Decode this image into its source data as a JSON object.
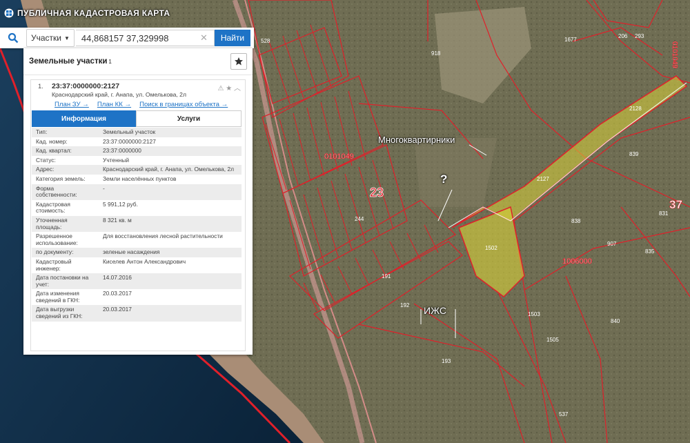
{
  "app": {
    "title": "ПУБЛИЧНАЯ КАДАСТРОВАЯ КАРТА"
  },
  "search": {
    "type_label": "Участки",
    "value": "44,868157 37,329998",
    "button_label": "Найти"
  },
  "results": {
    "header": "Земельные участки",
    "count": "1",
    "item": {
      "index": "1.",
      "cadastral_number": "23:37:0000000:2127",
      "address": "Краснодарский край, г. Анапа, ул. Омелькова, 2л",
      "links": {
        "plan_zu": "План ЗУ →",
        "plan_kk": "План КК →",
        "search_bounds": "Поиск в границах объекта →"
      },
      "tabs": {
        "info": "Информация",
        "services": "Услуги"
      },
      "rows": [
        {
          "key": "Тип:",
          "value": "Земельный участок"
        },
        {
          "key": "Кад. номер:",
          "value": "23:37:0000000:2127"
        },
        {
          "key": "Кад. квартал:",
          "value": "23:37:0000000"
        },
        {
          "key": "Статус:",
          "value": "Учтенный"
        },
        {
          "key": "Адрес:",
          "value": "Краснодарский край, г. Анапа, ул. Омелькова, 2л"
        },
        {
          "key": "Категория земель:",
          "value": "Земли населённых пунктов"
        },
        {
          "key": "Форма собственности:",
          "value": "-"
        },
        {
          "key": "Кадастровая стоимость:",
          "value": "5 991,12 руб."
        },
        {
          "key": "Уточненная площадь:",
          "value": "8 321 кв. м"
        },
        {
          "key": "Разрешенное использование:",
          "value": "Для восстановления лесной растительности"
        },
        {
          "key": "по документу:",
          "value": "зеленые насаждения"
        },
        {
          "key": "Кадастровый инженер:",
          "value": "Киселев Антон Александрович"
        },
        {
          "key": "Дата постановки на учет:",
          "value": "14.07.2016"
        },
        {
          "key": "Дата изменения сведений в ГКН:",
          "value": "20.03.2017"
        },
        {
          "key": "Дата выгрузки сведений из ГКН:",
          "value": "20.03.2017"
        }
      ]
    }
  },
  "map": {
    "annotations": {
      "apartments": "Многоквартирники",
      "question": "?",
      "izhs": "ИЖС",
      "quarter_23": "23",
      "quarter_37": "37"
    },
    "labels": {
      "q0101049": "0101049",
      "q0101049b": "0101049",
      "q1006000": "1006000",
      "p2127": "2127",
      "p1502": "1502",
      "p2128": "2128",
      "p918": "918",
      "p244": "244",
      "p191": "191",
      "p192": "192",
      "p193": "193",
      "p1503": "1503",
      "p1505": "1505",
      "p838": "838",
      "p839": "839",
      "p835": "835",
      "p840": "840",
      "p907": "907",
      "p537": "537",
      "p1677": "1677",
      "p528": "528",
      "p206": "206",
      "p293": "293",
      "p831": "831"
    },
    "colors": {
      "parcel_line": "#e0202a",
      "highlight_fill": "#d9d23a",
      "sea": "#0e2f4e",
      "ground": "#6b6a52"
    }
  }
}
